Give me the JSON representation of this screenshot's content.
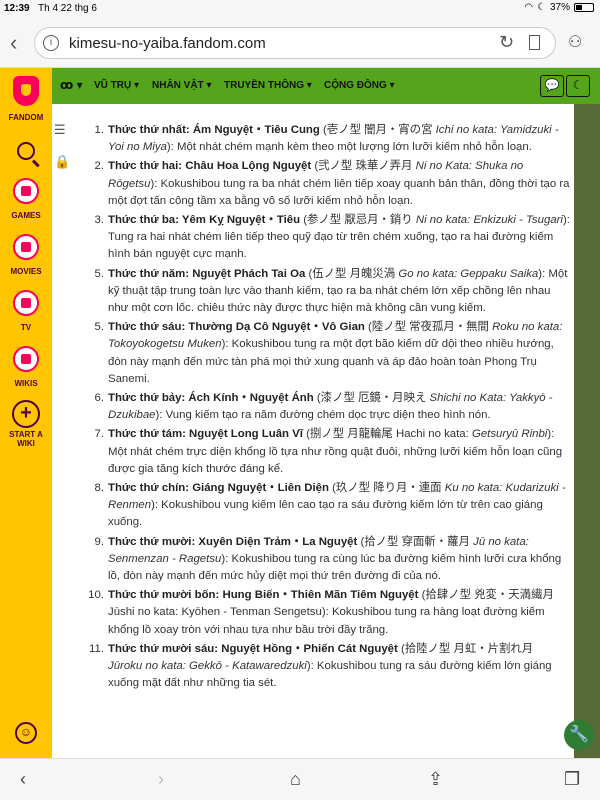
{
  "status": {
    "time": "12:39",
    "date": "Th 4 22 thg 6",
    "battery": "37%",
    "battery_level": 0.37
  },
  "browser": {
    "url": "kimesu-no-yaiba.fandom.com",
    "back_icon": "chevron-left-icon",
    "info_icon": "info-icon",
    "reload_icon": "reload-icon",
    "bookmark_icon": "bookmark-icon",
    "voice_icon": "voice-icon"
  },
  "rail": {
    "logo_label": "FANDOM",
    "items": [
      {
        "label": "GAMES",
        "icon": "gamepad-icon"
      },
      {
        "label": "MOVIES",
        "icon": "film-icon"
      },
      {
        "label": "TV",
        "icon": "tv-icon"
      },
      {
        "label": "WIKIS",
        "icon": "book-icon"
      },
      {
        "label": "START A WIKI",
        "icon": "plus-icon"
      }
    ]
  },
  "nav": {
    "home_glyph": "ꝏ ▾",
    "items": [
      "VŨ TRỤ ▾",
      "NHÂN VẬT ▾",
      "TRUYỀN THÔNG ▾",
      "CỘNG ĐỒNG ▾"
    ],
    "btn_discussions": "💬",
    "btn_theme": "☾"
  },
  "list": [
    {
      "num": "1.",
      "name": "Thức thứ nhất: Ám Nguyệt・Tiêu Cung",
      "jp_native": " (壱ノ型 闇月・宵の宮 ",
      "jp_romaji": "Ichi no kata: Yamidzuki - Yoi no Miya",
      "desc": "): Một nhát chém mạnh kèm theo một lượng lớn lưỡi kiếm nhỏ hỗn loạn."
    },
    {
      "num": "2.",
      "name": "Thức thứ hai: Châu Hoa Lộng Nguyệt",
      "jp_native": " (弐ノ型 珠華ノ弄月 ",
      "jp_romaji": "Ni no Kata: Shuka no Rōgetsu",
      "desc": "): Kokushibou tung ra ba nhát chém liên tiếp xoay quanh bản thân, đồng thời tạo ra một đợt tấn công tầm xa bằng vô số lưỡi kiếm nhỏ hỗn loạn."
    },
    {
      "num": "3.",
      "name": "Thức thứ ba: Yêm Kỵ Nguyệt・Tiêu",
      "jp_native": " (参ノ型 厭忌月・銷り ",
      "jp_romaji": "Ni no kata: Enkizuki - Tsugari",
      "desc": "): Tung ra hai nhát chém liên tiếp theo quỹ đạo từ trên chém xuống, tạo ra hai đường kiếm hình bán nguyệt cực mạnh."
    },
    {
      "num": "5.",
      "name": "Thức thứ năm: Nguyệt Phách Tai Oa",
      "jp_native": " (伍ノ型 月魄災渦 ",
      "jp_romaji": "Go no kata: Geppaku Saika",
      "desc": "): Một kỹ thuật tập trung toàn lực vào thanh kiếm, tạo ra ba nhát chém lớn xếp chồng lên nhau như một cơn lốc. chiêu thức này được thực hiện mà không cần vung kiếm."
    },
    {
      "num": "5.",
      "name": "Thức thứ sáu: Thường Dạ Cô Nguyệt・Vô Gian",
      "jp_native": " (陸ノ型 常夜孤月・無間 ",
      "jp_romaji": "Roku no kata: Tokoyokogetsu Muken",
      "desc": "): Kokushibou tung ra một đợt bão kiếm dữ dội theo nhiều hướng, đòn này mạnh đến mức tàn phá mọi thứ xung quanh và áp đảo hoàn toàn Phong Trụ Sanemi."
    },
    {
      "num": "6.",
      "name": "Thức thứ bảy: Ách Kính・Nguyệt Ánh",
      "jp_native": " (漆ノ型 厄鏡・月映え ",
      "jp_romaji": "Shichi no Kata: Yakkyō - Dzukibae",
      "desc": "): Vung kiếm tạo ra năm đường chém dọc trực diện theo hình nón."
    },
    {
      "num": "7.",
      "name": "Thức thứ tám: Nguyệt Long Luân Vĩ",
      "jp_native": " (捌ノ型 月龍輪尾 Hachi no kata: ",
      "jp_romaji": "Getsuryū Rinbi",
      "desc": "): Một nhát chém trực diện khổng lồ tựa như rồng quật đuôi, những lưỡi kiếm hỗn loạn cũng được gia tăng kích thước đáng kể."
    },
    {
      "num": "8.",
      "name": "Thức thứ chín: Giáng Nguyệt・Liên Diện",
      "jp_native": " (玖ノ型 降り月・連面 ",
      "jp_romaji": "Ku no kata: Kudarizuki - Renmen",
      "desc": "): Kokushibou vung kiếm lên cao tạo ra sáu đường kiếm lớn từ trên cao giáng xuống."
    },
    {
      "num": "9.",
      "name": "Thức thứ mười: Xuyên Diện Trảm・La Nguyệt",
      "jp_native": " (拾ノ型 穿面斬・蘿月 ",
      "jp_romaji": "Jū no kata: Senmenzan - Ragetsu",
      "desc": "): Kokushibou tung ra cùng lúc ba đường kiếm hình lưỡi cưa khổng lồ, đòn này mạnh đến mức hủy diệt mọi thứ trên đường đi của nó."
    },
    {
      "num": "10.",
      "name": "Thức thứ mười bốn: Hung Biến・Thiên Mãn Tiêm Nguyệt",
      "jp_native": " (拾肆ノ型 兇変・天満繊月 Jūshi no kata: Kyōhen - Tenman Sengetsu",
      "jp_romaji": "",
      "desc": "): Kokushibou tung ra hàng loạt đường kiếm khổng lồ xoay tròn với nhau tựa như bầu trời đầy trăng."
    },
    {
      "num": "11.",
      "name": "Thức thứ mười sáu: Nguyệt Hồng・Phiến Cát Nguyệt",
      "jp_native": " (拾陸ノ型 月虹・片割れ月 ",
      "jp_romaji": "Jūroku no kata: Gekkō - Katawaredzuki",
      "desc": "): Kokushibou tung ra sáu đường kiếm lớn giáng xuống mặt đất như những tia sét."
    }
  ],
  "colors": {
    "rail": "#ffc500",
    "nav": "#54a41c",
    "strip": "#576a38",
    "brand": "#fa005a"
  }
}
